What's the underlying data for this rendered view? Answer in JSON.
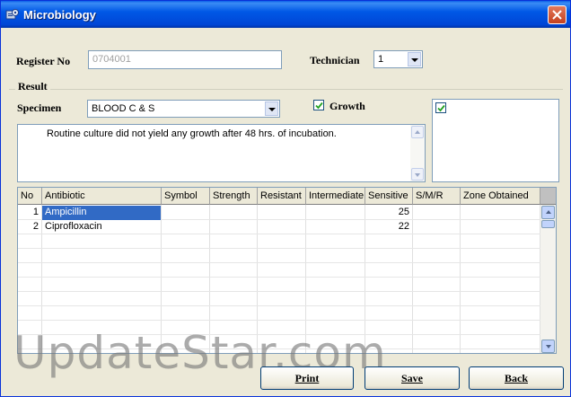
{
  "window": {
    "title": "Microbiology",
    "app_icon": "gear-app-icon",
    "close_icon": "close-icon"
  },
  "register": {
    "label": "Register No",
    "value": "0704001"
  },
  "technician": {
    "label": "Technician",
    "value": "1"
  },
  "result": {
    "group_label": "Result"
  },
  "specimen": {
    "label": "Specimen",
    "value": "BLOOD  C & S"
  },
  "growth": {
    "label": "Growth",
    "checked": true
  },
  "remarks": {
    "text": "Routine culture did not yield any growth after 48 hrs. of incubation."
  },
  "side_check": {
    "checked": true
  },
  "grid": {
    "headers": [
      "No",
      "Antibiotic",
      "Symbol",
      "Strength",
      "Resistant",
      "Intermediate",
      "Sensitive",
      "S/M/R",
      "Zone Obtained"
    ],
    "rows": [
      {
        "no": "1",
        "antibiotic": "Ampicillin",
        "symbol": "",
        "strength": "",
        "resistant": "",
        "intermediate": "",
        "sensitive": "25",
        "smr": "",
        "zone": ""
      },
      {
        "no": "2",
        "antibiotic": "Ciprofloxacin",
        "symbol": "",
        "strength": "",
        "resistant": "",
        "intermediate": "",
        "sensitive": "22",
        "smr": "",
        "zone": ""
      }
    ],
    "selected_cell": "Ampicillin"
  },
  "buttons": {
    "print": "Print",
    "save": "Save",
    "back": "Back"
  },
  "watermark": "UpdateStar.com",
  "colors": {
    "title_bar": "#0058e6",
    "window_bg": "#ece9d8",
    "selection": "#316ac5",
    "close_button": "#c4401e"
  }
}
